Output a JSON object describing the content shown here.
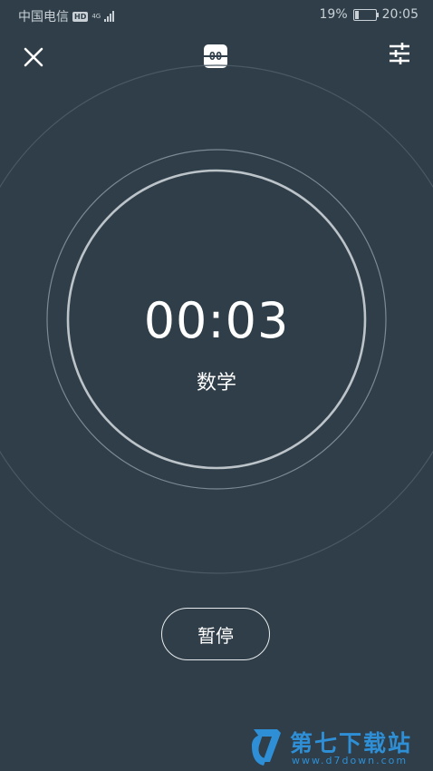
{
  "status_bar": {
    "carrier": "中国电信",
    "hd_badge": "HD",
    "network": "4G",
    "battery": "19%",
    "time": "20:05"
  },
  "toolbar": {
    "close_icon": "close-icon",
    "flip_clock_icon": "flip-clock-icon",
    "flip_clock_label": "00",
    "settings_icon": "sliders-icon"
  },
  "timer": {
    "elapsed": "00:03",
    "subject": "数学"
  },
  "controls": {
    "pause_label": "暂停"
  },
  "watermark": {
    "logo_icon": "d7-logo",
    "name": "第七下载站",
    "url": "www.d7down.com"
  },
  "colors": {
    "background": "#2f3e48",
    "ring": "#bcc4ca",
    "watermark": "#2e8fd6"
  }
}
